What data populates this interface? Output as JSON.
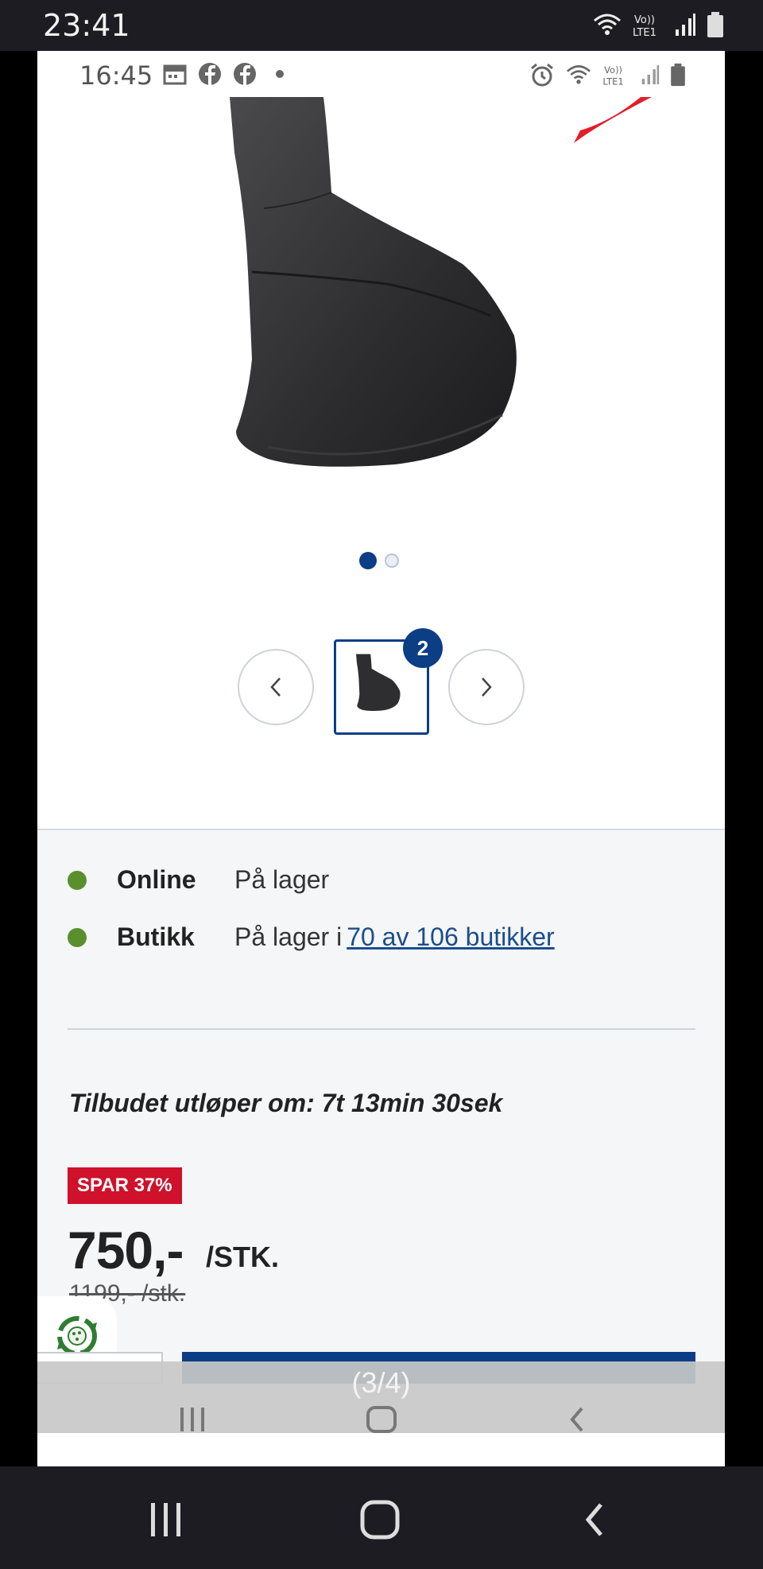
{
  "outer_status": {
    "time": "23:41"
  },
  "inner_status": {
    "time": "16:45"
  },
  "gallery": {
    "active_dot": 1,
    "thumbnail_count_badge": "2",
    "prev_label": "‹",
    "next_label": "›"
  },
  "stock": {
    "online": {
      "label": "Online",
      "status": "På lager"
    },
    "store": {
      "label": "Butikk",
      "status": "På lager i",
      "link": "70 av 106 butikker"
    },
    "status_color": "#5a8f2d"
  },
  "offer": {
    "countdown": "Tilbudet utløper om: 7t 13min 30sek",
    "save_badge": "SPAR 37%",
    "price": "750,-",
    "unit": "/STK.",
    "old_price": "1199,- /stk."
  },
  "overlay": {
    "counter": "(3/4)"
  },
  "colors": {
    "brand_blue": "#0b3e85",
    "save_red": "#d0112b",
    "logo_red": "#e31e2b"
  },
  "icons": {
    "outer_status": [
      "wifi-icon",
      "volte-icon",
      "signal-icon",
      "battery-icon"
    ],
    "inner_status_left": [
      "calendar-icon",
      "facebook-icon",
      "facebook-icon",
      "dot-icon"
    ],
    "inner_status_right": [
      "alarm-icon",
      "wifi-icon",
      "volte-icon",
      "signal-icon",
      "battery-icon"
    ],
    "nav": [
      "recents-icon",
      "home-icon",
      "back-icon"
    ]
  }
}
